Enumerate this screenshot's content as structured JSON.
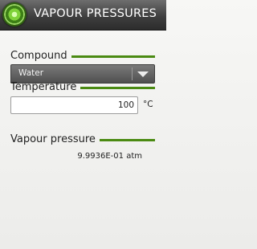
{
  "header": {
    "title": "VAPOUR PRESSURES",
    "icon": "app-logo-icon"
  },
  "compound": {
    "label": "Compound",
    "selected": "Water"
  },
  "temperature": {
    "label": "Temperature",
    "value": "100",
    "unit": "°C"
  },
  "vapour_pressure": {
    "label": "Vapour pressure",
    "value": "9.9936E-01 atm"
  },
  "colors": {
    "accent": "#4a8a12",
    "titlebar": "#3f3f3f"
  }
}
